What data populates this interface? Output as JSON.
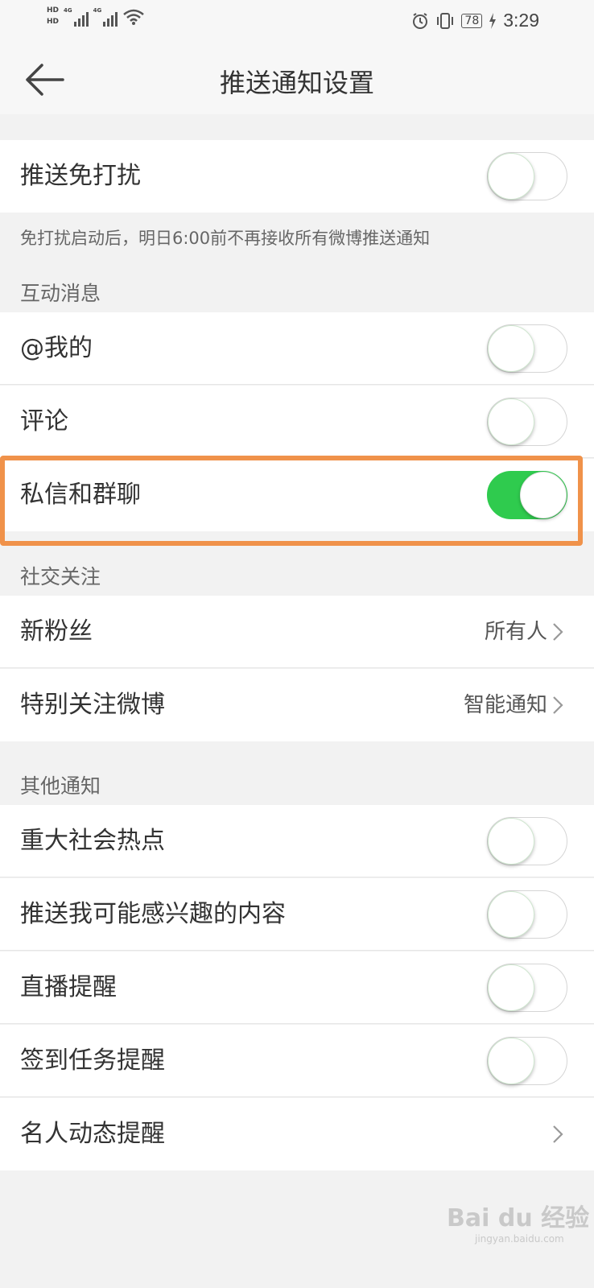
{
  "status_bar": {
    "hd1": "HD",
    "hd2": "HD",
    "sim1_label": "4G",
    "sim2_label": "4G",
    "battery": "78",
    "time": "3:29"
  },
  "header": {
    "title": "推送通知设置",
    "back_icon": "back-arrow-icon"
  },
  "dnd": {
    "label": "推送免打扰",
    "on": false,
    "note": "免打扰启动后，明日6:00前不再接收所有微博推送通知"
  },
  "interaction": {
    "section_title": "互动消息",
    "items": [
      {
        "label": "@我的",
        "on": false
      },
      {
        "label": "评论",
        "on": false
      },
      {
        "label": "私信和群聊",
        "on": true
      }
    ]
  },
  "social": {
    "section_title": "社交关注",
    "items": [
      {
        "label": "新粉丝",
        "value": "所有人"
      },
      {
        "label": "特别关注微博",
        "value": "智能通知"
      }
    ]
  },
  "other": {
    "section_title": "其他通知",
    "items": [
      {
        "label": "重大社会热点",
        "on": false
      },
      {
        "label": "推送我可能感兴趣的内容",
        "on": false
      },
      {
        "label": "直播提醒",
        "on": false
      },
      {
        "label": "签到任务提醒",
        "on": false
      },
      {
        "label": "名人动态提醒"
      }
    ]
  },
  "watermark": {
    "brand": "Bai du 经验",
    "url": "jingyan.baidu.com"
  },
  "colors": {
    "toggle_on": "#2fcb4e",
    "highlight": "#f0924a",
    "background": "#f2f2f2"
  }
}
